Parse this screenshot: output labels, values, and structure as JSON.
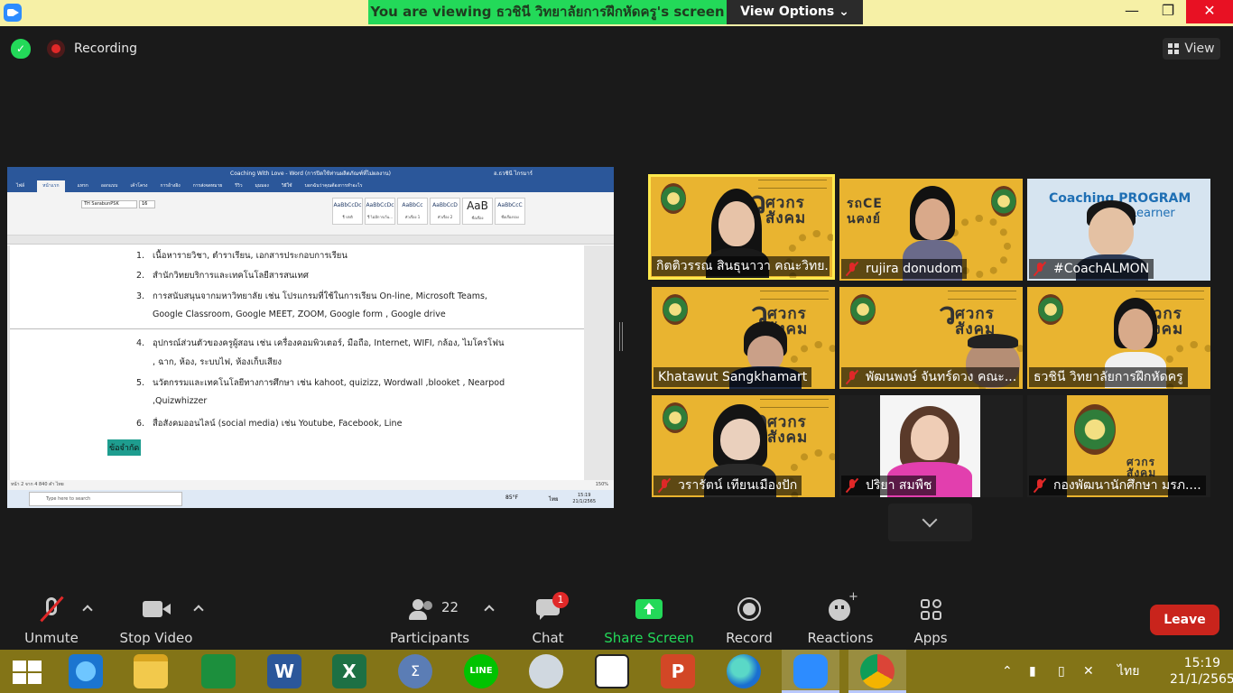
{
  "topbar": {
    "banner": "You are viewing ธวชินี วิทยาลัยการฝึกหัดครู's screen",
    "view_options": "View Options ⌄"
  },
  "recording": {
    "label": "Recording"
  },
  "view_button": {
    "label": "View"
  },
  "shared_doc": {
    "window_title": "Coaching With Love - Word (การปิดใช้ท่านผลิตภัณฑ์ที่ไม่ผลงาน)",
    "window_user": "อ.ธวชินี ไกรมาร์",
    "tabs": [
      "ไฟล์",
      "หน้าแรก",
      "แทรก",
      "ออกแบบ",
      "เค้าโครง",
      "การอ้างอิง",
      "การส่งจดหมาย",
      "รีวิว",
      "มุมมอง",
      "วิธีใช้",
      "บอกฉันว่าคุณต้องการทำอะไร"
    ],
    "font_name": "TH SarabunPSK",
    "font_size": "16",
    "styles": [
      {
        "preview": "AaBbCcDc",
        "name": "¶ ปกติ"
      },
      {
        "preview": "AaBbCcDc",
        "name": "¶ ไม่มีการเว้น..."
      },
      {
        "preview": "AaBbCc",
        "name": "หัวเรื่อง 1"
      },
      {
        "preview": "AaBbCcD",
        "name": "หัวเรื่อง 2"
      },
      {
        "preview": "AaB",
        "name": "ชื่อเรื่อง"
      },
      {
        "preview": "AaBbCcC",
        "name": "ชื่อเรื่องรอง"
      }
    ],
    "lines": [
      {
        "num": "1.",
        "text": "เนื้อหารายวิชา,  ตำราเรียน,  เอกสารประกอบการเรียน"
      },
      {
        "num": "2.",
        "text": "สำนักวิทยบริการและเทคโนโลยีสารสนเทศ"
      },
      {
        "num": "3.",
        "text": "การสนับสนุนจากมหาวิทยาลัย  เช่น  โปรแกรมที่ใช้ในการเรียน  On-line,  Microsoft Teams,"
      },
      {
        "num": "",
        "text": "Google  Classroom,  Google  MEET, ZOOM, Google form , Google drive"
      },
      {
        "num": "4.",
        "text": "อุปกรณ์ส่วนตัวของครูผู้สอน  เช่น  เครื่องคอมพิวเตอร์,  มือถือ,  Internet,  WIFI, กล้อง, ไมโครโฟน"
      },
      {
        "num": "",
        "text": ", ฉาก, ห้อง, ระบบไฟ, ห้องเก็บเสียง"
      },
      {
        "num": "5.",
        "text": "นวัตกรรมและเทคโนโลยีทางการศึกษา  เช่น  kahoot, quizizz, Wordwall ,blooket , Nearpod"
      },
      {
        "num": "",
        "text": ",Quizwhizzer"
      },
      {
        "num": "6.",
        "text": "สื่อสังคมออนไลน์  (social  media) เช่น  Youtube, Facebook, Line"
      }
    ],
    "highlight": "ข้อจำกัด",
    "status": "หน้า 2 จาก 4    840 คำ    ไทย",
    "zoom_pct": "150%",
    "search_placeholder": "Type here to search",
    "temp": "85°F",
    "lang": "ไทย",
    "time": "15:19",
    "date": "21/1/2565"
  },
  "participants_tiles": [
    {
      "name": "กิตติวรรณ สินธุนาวา คณะวิทย...",
      "muted": false
    },
    {
      "name": "rujira donudom",
      "muted": true
    },
    {
      "name": "#CoachALMON",
      "muted": true
    },
    {
      "name": "Khatawut Sangkhamart",
      "muted": false
    },
    {
      "name": "พัฒนพงษ์ จันทร์ดวง คณะ...",
      "muted": true
    },
    {
      "name": "ธวชินี  วิทยาลัยการฝึกหัดครู",
      "muted": false
    },
    {
      "name": "วรารัตน์ เทียนเมืองปัก",
      "muted": true
    },
    {
      "name": "ปริยา สมพืช",
      "muted": true
    },
    {
      "name": "กองพัฒนานักศึกษา มรภ....",
      "muted": true
    }
  ],
  "tile_texts": {
    "brand_top": "ศวกร",
    "brand_bottom": "สังคม",
    "brand_alt_top": "รถCE",
    "brand_alt_bottom": "นคงย์",
    "coaching": "Coaching PROGRAM",
    "coaching_sub": "for Learner"
  },
  "controls": {
    "unmute": "Unmute",
    "stop_video": "Stop Video",
    "participants": "Participants",
    "participants_count": "22",
    "chat": "Chat",
    "chat_badge": "1",
    "share_screen": "Share Screen",
    "record": "Record",
    "reactions": "Reactions",
    "apps": "Apps",
    "leave": "Leave"
  },
  "taskbar": {
    "lang": "ไทย",
    "time": "15:19",
    "date": "21/1/2565"
  },
  "colors": {
    "banner_green": "#23d959",
    "leave_red": "#c9241c",
    "tile_gold": "#e9b430",
    "taskbar_olive": "#837417"
  }
}
